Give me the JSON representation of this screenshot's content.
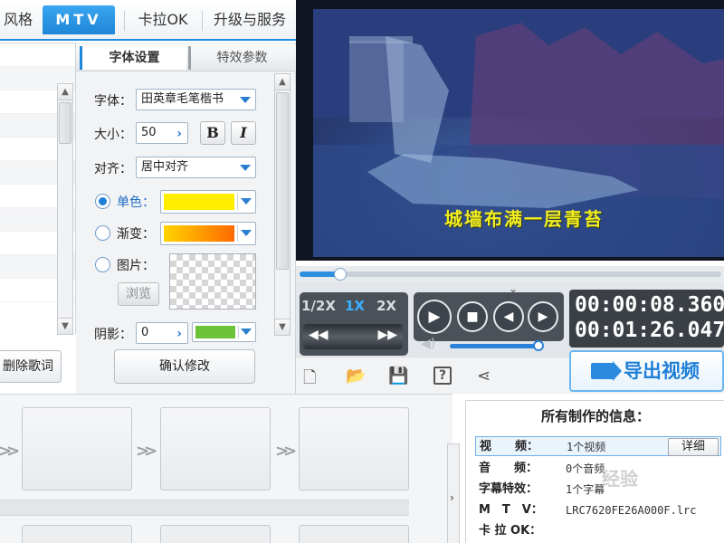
{
  "tabs": [
    {
      "label": "风格",
      "active": false
    },
    {
      "label": "MTV",
      "active": true
    },
    {
      "label": "卡拉OK",
      "active": false
    },
    {
      "label": "升级与服务",
      "active": false
    }
  ],
  "left_panel": {
    "delete_lyrics_label": "删除歌词"
  },
  "settings": {
    "subtabs": [
      "字体设置",
      "特效参数"
    ],
    "font_label": "字体：",
    "font_value": "田英章毛笔楷书",
    "size_label": "大小：",
    "size_value": "50",
    "bold_label": "B",
    "italic_label": "I",
    "align_label": "对齐：",
    "align_value": "居中对齐",
    "solid_label": "单色：",
    "gradient_label": "渐变：",
    "image_label": "图片：",
    "browse_label": "浏览",
    "shadow_label": "阴影：",
    "shadow_value": "0",
    "confirm_label": "确认修改",
    "colors": {
      "solid": "#ffee00",
      "gradient_start": "#ffd400",
      "gradient_end": "#ff6a00",
      "shadow": "#6cc33a"
    }
  },
  "player": {
    "lyric_text": "城墙布满一层青苔",
    "progress": 0.096,
    "speeds": [
      "1/2X",
      "1X",
      "2X"
    ],
    "active_speed": "1X",
    "current_time": "00:00:08.360",
    "total_time": "00:01:26.047",
    "volume": 1.0
  },
  "toolbar": {
    "icons": [
      "new-icon",
      "open-folder-icon",
      "save-icon",
      "help-icon",
      "share-icon"
    ],
    "export_label": "导出视频"
  },
  "info": {
    "title": "所有制作的信息：",
    "rows": [
      {
        "key": "视　　频：",
        "value": "1个视频",
        "selected": true,
        "action": "详细"
      },
      {
        "key": "音　　频：",
        "value": "0个音频",
        "selected": false
      },
      {
        "key": "字幕特效：",
        "value": "1个字幕",
        "selected": false
      },
      {
        "key": "M　T　V：",
        "value": "LRC7620FE26A000F.lrc",
        "selected": false
      },
      {
        "key": "卡 拉 OK：",
        "value": "",
        "selected": false
      }
    ],
    "watermark": "经验"
  }
}
